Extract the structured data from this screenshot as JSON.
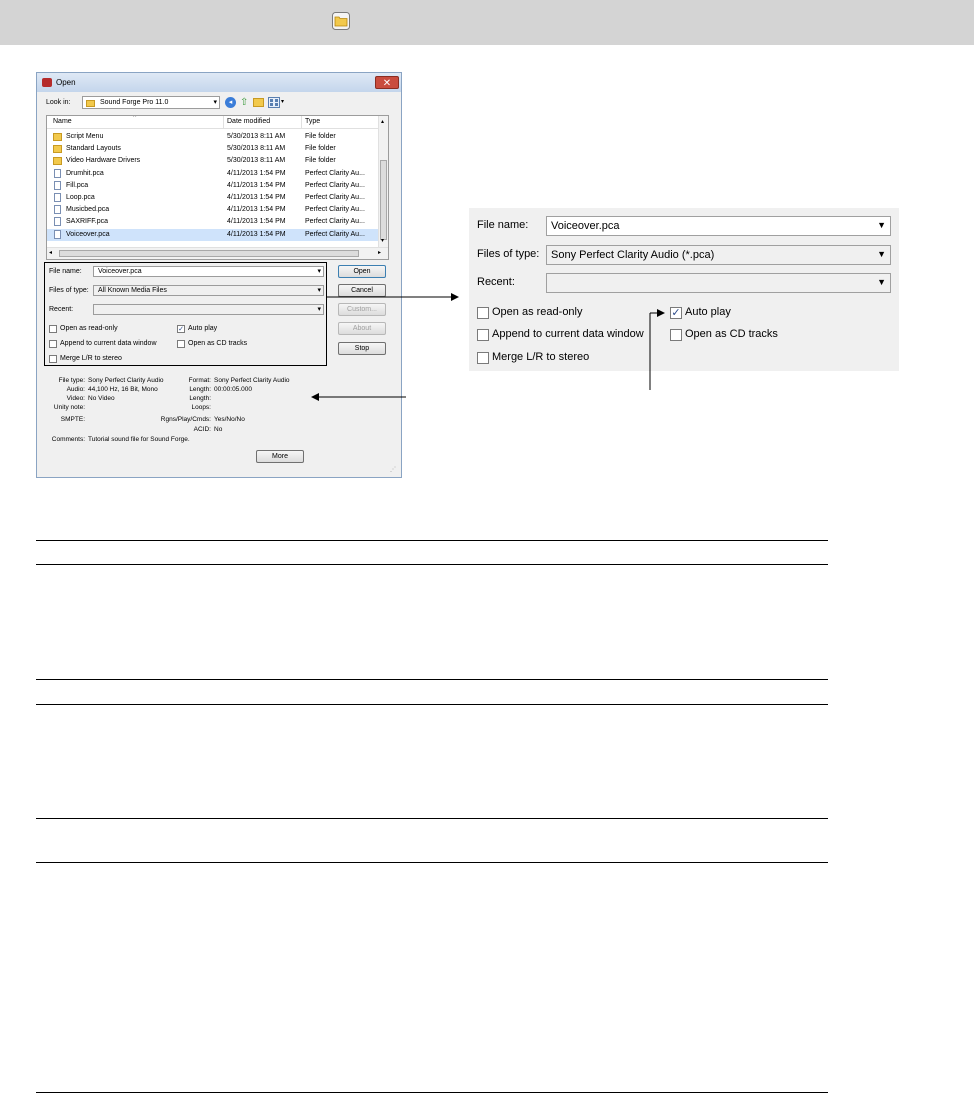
{
  "dialog": {
    "title": "Open",
    "close_label": "✕",
    "look_in": {
      "label": "Look in:",
      "value": "Sound Forge Pro 11.0"
    },
    "columns": {
      "name": "Name",
      "date": "Date modified",
      "type": "Type"
    },
    "files": [
      {
        "name": "Script Menu",
        "date": "5/30/2013 8:11 AM",
        "type": "File folder",
        "kind": "folder"
      },
      {
        "name": "Standard Layouts",
        "date": "5/30/2013 8:11 AM",
        "type": "File folder",
        "kind": "folder"
      },
      {
        "name": "Video Hardware Drivers",
        "date": "5/30/2013 8:11 AM",
        "type": "File folder",
        "kind": "folder"
      },
      {
        "name": "Drumhit.pca",
        "date": "4/11/2013 1:54 PM",
        "type": "Perfect Clarity Au...",
        "kind": "file"
      },
      {
        "name": "Fill.pca",
        "date": "4/11/2013 1:54 PM",
        "type": "Perfect Clarity Au...",
        "kind": "file"
      },
      {
        "name": "Loop.pca",
        "date": "4/11/2013 1:54 PM",
        "type": "Perfect Clarity Au...",
        "kind": "file"
      },
      {
        "name": "Musicbed.pca",
        "date": "4/11/2013 1:54 PM",
        "type": "Perfect Clarity Au...",
        "kind": "file"
      },
      {
        "name": "SAXRIFF.pca",
        "date": "4/11/2013 1:54 PM",
        "type": "Perfect Clarity Au...",
        "kind": "file"
      },
      {
        "name": "Voiceover.pca",
        "date": "4/11/2013 1:54 PM",
        "type": "Perfect Clarity Au...",
        "kind": "file",
        "selected": true
      }
    ],
    "file_name": {
      "label": "File name:",
      "value": "Voiceover.pca"
    },
    "files_of_type": {
      "label": "Files of type:",
      "value": "All Known Media Files"
    },
    "recent": {
      "label": "Recent:",
      "value": ""
    },
    "options": {
      "open_read_only": "Open as read-only",
      "auto_play": "Auto play",
      "append": "Append to current data window",
      "open_cd": "Open as CD tracks",
      "merge": "Merge L/R to stereo"
    },
    "buttons": {
      "open": "Open",
      "cancel": "Cancel",
      "custom": "Custom...",
      "about": "About",
      "stop": "Stop",
      "more": "More"
    },
    "info": {
      "file_type_label": "File type:",
      "file_type": "Sony Perfect Clarity Audio",
      "audio_label": "Audio:",
      "audio": "44,100 Hz, 16 Bit, Mono",
      "video_label": "Video:",
      "video": "No Video",
      "unity_label": "Unity note:",
      "smpte_label": "SMPTE:",
      "format_label": "Format:",
      "format": "Sony Perfect Clarity Audio",
      "length_label": "Length:",
      "length": "00:00:05.000",
      "length2_label": "Length:",
      "loops_label": "Loops:",
      "rgns_label": "Rgns/Play/Cmds:",
      "rgns": "Yes/No/No",
      "acid_label": "ACID:",
      "acid": "No",
      "comments_label": "Comments:",
      "comments": "Tutorial sound file for Sound Forge."
    }
  },
  "zoom": {
    "file_name_label": "File name:",
    "file_name_value": "Voiceover.pca",
    "files_of_type_label": "Files of type:",
    "files_of_type_value": "Sony Perfect Clarity Audio (*.pca)",
    "recent_label": "Recent:",
    "open_read_only": "Open as read-only",
    "auto_play": "Auto play",
    "append": "Append to current data window",
    "open_cd": "Open as CD tracks",
    "merge": "Merge L/R to stereo"
  },
  "icons": {
    "header_folder": "folder-icon",
    "checkmark": "✓"
  }
}
